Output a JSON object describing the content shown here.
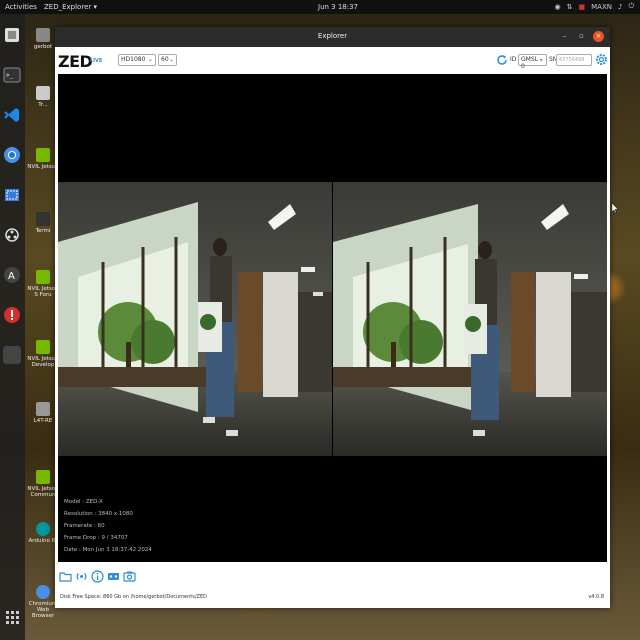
{
  "topbar": {
    "activities": "Activities",
    "app_menu": "ZED_Explorer ▾",
    "clock": "Jun 3  18:37",
    "nvidia_label": "MAXN"
  },
  "desktop_icons": [
    {
      "label": "gerbot"
    },
    {
      "label": "Tr..."
    },
    {
      "label": "NVIL Jetson"
    },
    {
      "label": "Termi"
    },
    {
      "label": "NVIL Jetson S Foru"
    },
    {
      "label": "NVIL Jetson Develop"
    },
    {
      "label": "L4T-RE"
    },
    {
      "label": "NVIL Jetson Commun"
    },
    {
      "label": "Arduino ID"
    },
    {
      "label": "Chromium Web Browser"
    }
  ],
  "window": {
    "title": "Explorer"
  },
  "toolbar": {
    "logo": "ZED",
    "live": "LIVE",
    "resolution": "HD1080",
    "fps": "60",
    "id_label": "ID",
    "camera": "GMSL - 0",
    "sn_label": "SN",
    "sn_placeholder": "43756498"
  },
  "overlay": {
    "model": "Model : ZED-X",
    "resolution": "Resolution : 3840 x 1080",
    "framerate": "Framerate : 60",
    "frame_drop": "Frame Drop : 9 / 34707",
    "date": "Date : Mon Jun 3 18:37:42 2024"
  },
  "status": {
    "disk": "Disk Free Space: 860 Gb  on  /home/gerbot/Documents/ZED",
    "version": "v4.0.8"
  },
  "colors": {
    "accent": "#2a8fd8",
    "close": "#e95420"
  }
}
